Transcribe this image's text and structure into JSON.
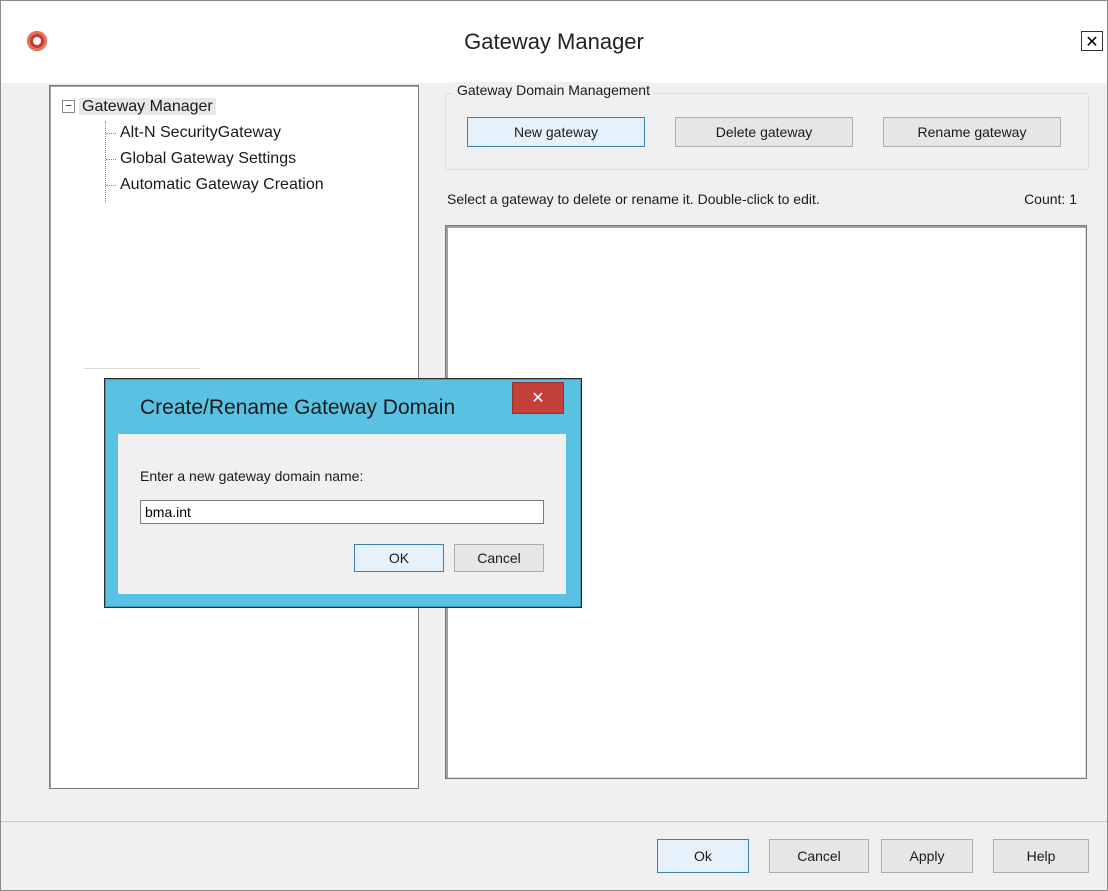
{
  "window": {
    "title": "Gateway Manager",
    "close_glyph": "✕"
  },
  "tree": {
    "root": {
      "label": "Gateway Manager",
      "expander": "−"
    },
    "items": [
      {
        "label": "Alt-N SecurityGateway"
      },
      {
        "label": "Global Gateway Settings"
      },
      {
        "label": "Automatic Gateway Creation"
      }
    ]
  },
  "management": {
    "group_title": "Gateway Domain Management",
    "new_label": "New gateway",
    "delete_label": "Delete gateway",
    "rename_label": "Rename gateway",
    "list_caption": "Select a gateway to delete or rename it.  Double-click to edit.",
    "count_label": "Count: 1"
  },
  "dialog": {
    "title": "Create/Rename Gateway Domain",
    "close_glyph": "✕",
    "prompt": "Enter a new gateway domain name:",
    "input_value": "bma.int",
    "ok_label": "OK",
    "cancel_label": "Cancel"
  },
  "footer": {
    "ok_label": "Ok",
    "cancel_label": "Cancel",
    "apply_label": "Apply",
    "help_label": "Help"
  },
  "colors": {
    "dialog_frame": "#5bc1e2",
    "dialog_close": "#c4413a",
    "app_icon": "#c73a2c"
  }
}
